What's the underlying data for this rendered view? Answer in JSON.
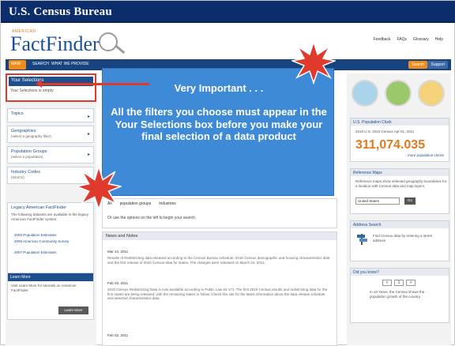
{
  "window": {
    "agency": "U.S. Census Bureau"
  },
  "header": {
    "logo_small": "AMERICAN",
    "logo": "FactFinder",
    "util_links": [
      "Feedback",
      "FAQs",
      "Glossary",
      "Help"
    ]
  },
  "nav": {
    "items": [
      "MAIN",
      "SEARCH",
      "WHAT WE PROVIDE"
    ],
    "search_btn": "Search",
    "support_btn": "Support"
  },
  "left": {
    "selections_title": "Your Selections",
    "selections_sub": "Your Selections is empty",
    "panels": [
      {
        "title": "Topics",
        "sub": ""
      },
      {
        "title": "Geographies",
        "sub": "(select a geography filter)"
      },
      {
        "title": "Population Groups",
        "sub": "(select a population)"
      },
      {
        "title": "Industry Codes",
        "sub": "(NAICS)"
      }
    ],
    "legacy_title": "Legacy American FactFinder",
    "legacy_text": "The following datasets are available in the legacy American FactFinder system:",
    "legacy_links": [
      "2000 Population Estimates",
      "2008 American Community Survey",
      "2007 Population Estimates"
    ],
    "learn_title": "Learn More",
    "learn_text": "Visit Learn More for tutorials on American FactFinder.",
    "learn_button": "Learn More"
  },
  "callout": {
    "heading": "Very Important . . .",
    "body": "All the filters you choose must appear in the Your Selections box before you make your final selection of a data product"
  },
  "center": {
    "filter_options": [
      "All",
      "population groups",
      "industries"
    ],
    "filter_help": "Or use the options on the left to begin your search.",
    "news_title": "News and Notes",
    "news": [
      {
        "date": "Mar 24, 2011",
        "text": "Results of Redistricting data released according to the Census Bureau schedule, 2010 Census demographic and housing characteristics data and the first release of 2010 Census data for states. The changes were released on March 24, 2011."
      },
      {
        "date": "Feb 03, 2011",
        "text": "2010 Census Redistricting Data is now available according to Public Law 94-171. The first 2010 Census results and redistricting data for the first states are being released, with the remaining states to follow. Check this site for the latest information about the data release schedule and selected characteristics data."
      },
      {
        "date": "Feb 03, 2011",
        "text": ""
      }
    ]
  },
  "right": {
    "pop_clock_title": "U.S. Population Clock",
    "pop_clock_text": "2010 U.S. 2010 Census Apr 01, 2011",
    "pop_number": "311,074.035",
    "pop_link": "more population clocks",
    "ref_title": "Reference Maps",
    "ref_text": "Reference maps show selected geography boundaries for a location with Census data and map layers.",
    "ref_select": "United States",
    "ref_go": "Go",
    "addr_title": "Address Search",
    "addr_text": "Find Census data by entering a street address.",
    "addr_link": "",
    "what_title": "Did you know?",
    "what_nav": [
      "<",
      "1",
      ">"
    ],
    "what_text": "In 10 Years, the Census shows the population growth of the country."
  },
  "colors": {
    "topbar": "#0b2d6b",
    "nav": "#17437e",
    "accent_orange": "#f08c1a",
    "callout": "#3f8ad6",
    "highlight_red": "#e03a2c",
    "pop_number": "#e07a1f"
  }
}
